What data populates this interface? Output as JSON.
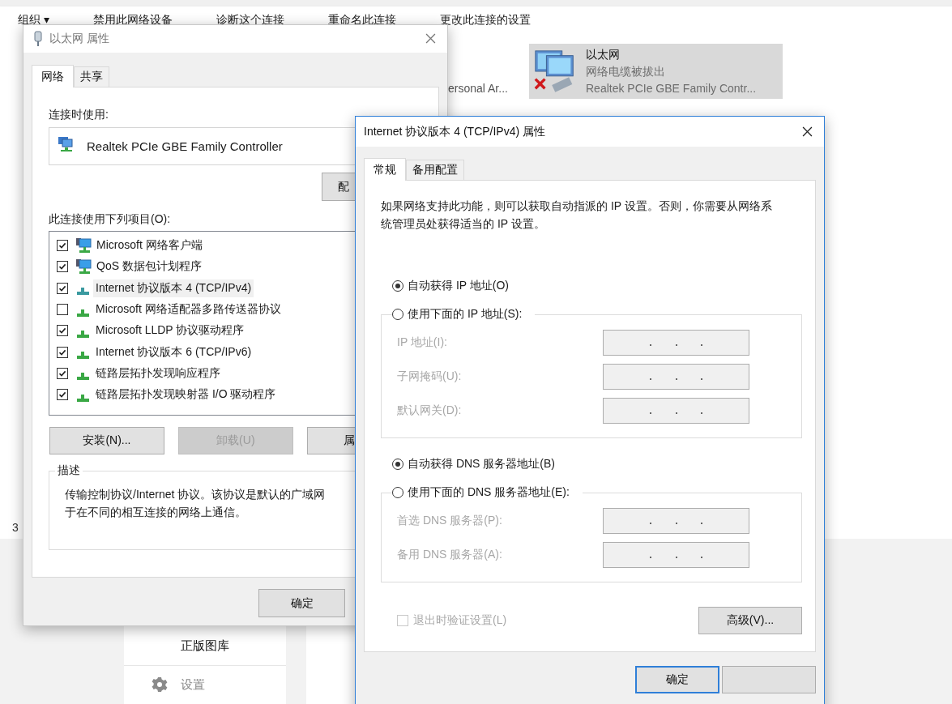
{
  "explorer": {
    "toolbar": [
      {
        "label": "组织 ▾"
      },
      {
        "label": "禁用此网络设备"
      },
      {
        "label": "诊断这个连接"
      },
      {
        "label": "重命名此连接"
      },
      {
        "label": "更改此连接的设置"
      }
    ],
    "partial_item": {
      "label": "ersonal Ar..."
    },
    "adapter": {
      "name": "以太网",
      "status": "网络电缆被拔出",
      "device": "Realtek PCIe GBE Family Contr...",
      "selected": true,
      "disconnected": true
    },
    "status_count": "3"
  },
  "side_panel": {
    "items": [
      {
        "label": "正版图库",
        "kind": "plain"
      },
      {
        "label": "设置",
        "kind": "gear"
      }
    ]
  },
  "ethernet_dialog": {
    "title": "以太网 属性",
    "tabs": [
      {
        "label": "网络",
        "selected": true
      },
      {
        "label": "共享",
        "selected": false
      }
    ],
    "connect_using_label": "连接时使用:",
    "adapter_name": "Realtek PCIe GBE Family Controller",
    "configure_button": "配",
    "items_label": "此连接使用下列项目(O):",
    "components": [
      {
        "label": "Microsoft 网络客户端",
        "checked": true,
        "selected": false,
        "kind": "client"
      },
      {
        "label": "QoS 数据包计划程序",
        "checked": true,
        "selected": false,
        "kind": "client"
      },
      {
        "label": "Internet 协议版本 4 (TCP/IPv4)",
        "checked": true,
        "selected": true,
        "kind": "protocol"
      },
      {
        "label": "Microsoft 网络适配器多路传送器协议",
        "checked": false,
        "selected": false,
        "kind": "protocol"
      },
      {
        "label": "Microsoft LLDP 协议驱动程序",
        "checked": true,
        "selected": false,
        "kind": "protocol"
      },
      {
        "label": "Internet 协议版本 6 (TCP/IPv6)",
        "checked": true,
        "selected": false,
        "kind": "protocol"
      },
      {
        "label": "链路层拓扑发现响应程序",
        "checked": true,
        "selected": false,
        "kind": "protocol"
      },
      {
        "label": "链路层拓扑发现映射器 I/O 驱动程序",
        "checked": true,
        "selected": false,
        "kind": "protocol"
      }
    ],
    "buttons": [
      {
        "label": "安装(N)...",
        "disabled": false
      },
      {
        "label": "卸载(U)",
        "disabled": true
      },
      {
        "label": "属",
        "disabled": false
      }
    ],
    "description_label": "描述",
    "description_lines": [
      "传输控制协议/Internet 协议。该协议是默认的广域网",
      "于在不同的相互连接的网络上通信。"
    ],
    "ok_button": "确定"
  },
  "ipv4_dialog": {
    "title": "Internet 协议版本 4 (TCP/IPv4) 属性",
    "tabs": [
      {
        "label": "常规",
        "selected": true
      },
      {
        "label": "备用配置",
        "selected": false
      }
    ],
    "intro": "如果网络支持此功能，则可以获取自动指派的 IP 设置。否则，你需要从网络系统管理员处获得适当的 IP 设置。",
    "ip_auto": {
      "label": "自动获得 IP 地址(O)",
      "selected": true
    },
    "ip_manual": {
      "label": "使用下面的 IP 地址(S):",
      "selected": false
    },
    "ip_fields": [
      {
        "label": "IP 地址(I):",
        "disabled": true
      },
      {
        "label": "子网掩码(U):",
        "disabled": true
      },
      {
        "label": "默认网关(D):",
        "disabled": true
      }
    ],
    "dns_auto": {
      "label": "自动获得 DNS 服务器地址(B)",
      "selected": true
    },
    "dns_manual": {
      "label": "使用下面的 DNS 服务器地址(E):",
      "selected": false
    },
    "dns_fields": [
      {
        "label": "首选 DNS 服务器(P):",
        "disabled": true
      },
      {
        "label": "备用 DNS 服务器(A):",
        "disabled": true
      }
    ],
    "validate": {
      "label": "退出时验证设置(L)",
      "checked": false,
      "disabled": true
    },
    "advanced_button": "高级(V)...",
    "ok_button": "确定"
  }
}
